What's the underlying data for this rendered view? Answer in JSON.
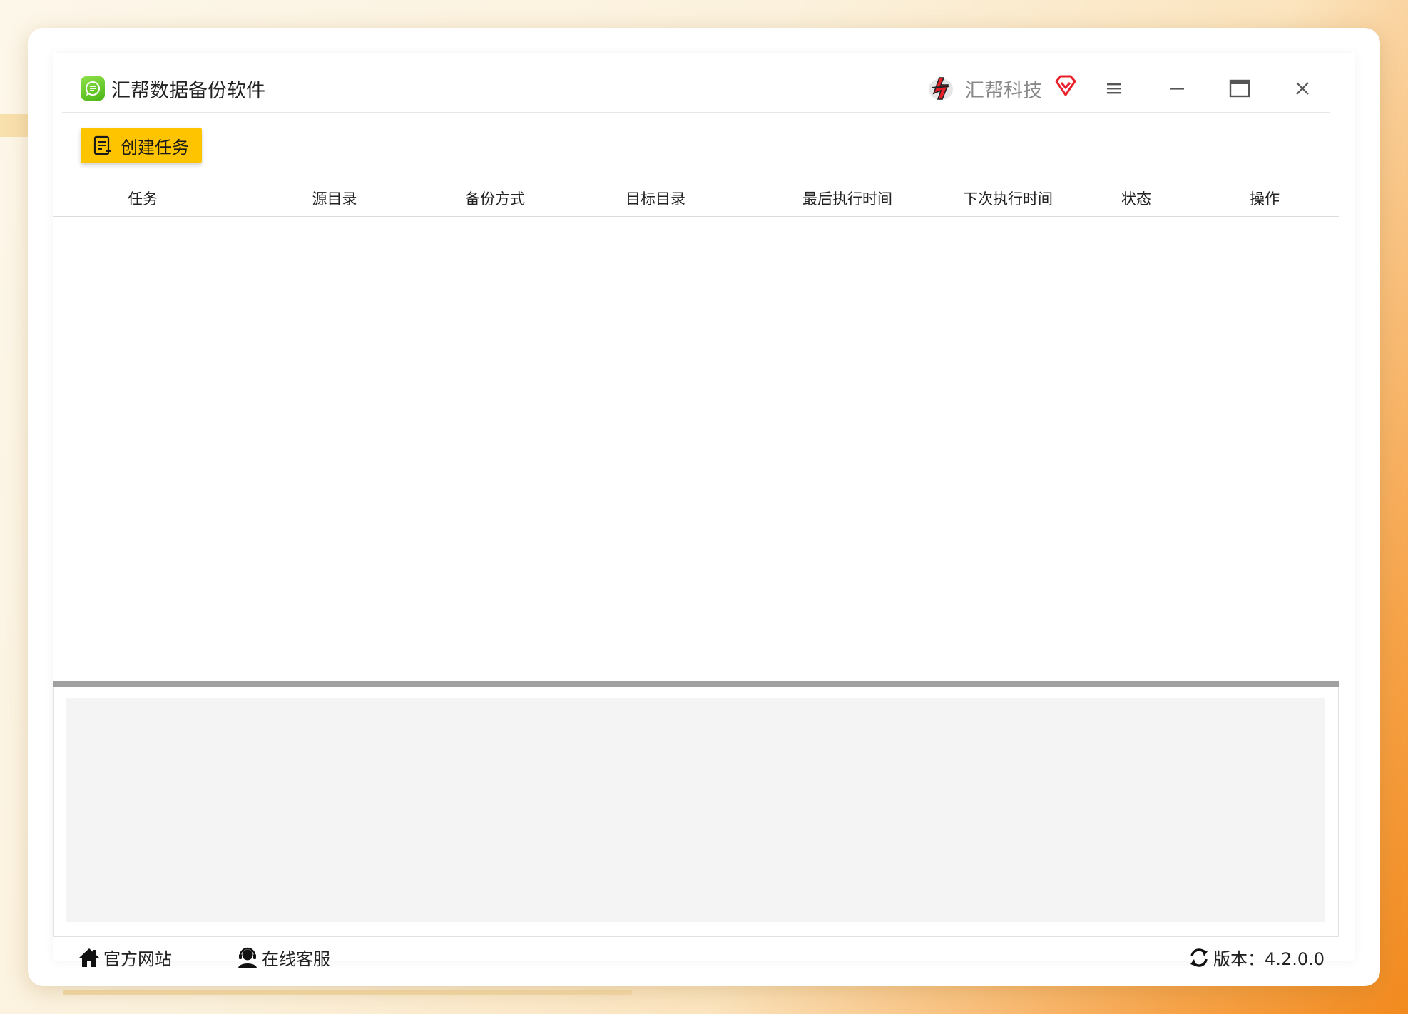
{
  "app": {
    "title": "汇帮数据备份软件",
    "brand_name": "汇帮科技",
    "icon": "app-logo-icon"
  },
  "window_controls": {
    "menu_icon": "hamburger-menu-icon",
    "minimize_icon": "minimize-icon",
    "maximize_icon": "maximize-icon",
    "close_icon": "close-icon"
  },
  "toolbar": {
    "create_task_label": "创建任务",
    "create_task_icon": "document-add-icon"
  },
  "table": {
    "columns": [
      "任务",
      "源目录",
      "备份方式",
      "目标目录",
      "最后执行时间",
      "下次执行时间",
      "状态",
      "操作"
    ],
    "rows": []
  },
  "footer": {
    "official_site_label": "官方网站",
    "online_support_label": "在线客服",
    "version_label": "版本：4.2.0.0"
  },
  "colors": {
    "accent_yellow": "#ffc400",
    "app_icon_green": "#5cc21f",
    "brand_red": "#e8202a",
    "splitter_gray": "#a0a0a0",
    "log_bg": "#f4f4f4"
  }
}
